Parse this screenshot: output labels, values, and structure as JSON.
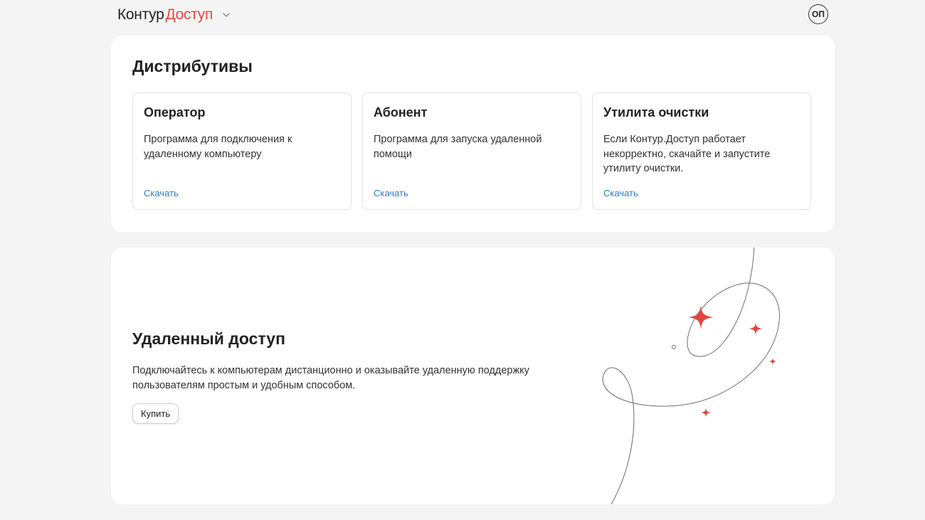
{
  "header": {
    "logo_brand": "Контур",
    "logo_product": "Доступ",
    "avatar_initials": "ОП"
  },
  "distributions": {
    "title": "Дистрибутивы",
    "cards": [
      {
        "title": "Оператор",
        "description": "Программа для подключения к удаленному компьютеру",
        "link_label": "Скачать"
      },
      {
        "title": "Абонент",
        "description": "Программа для запуска удаленной помощи",
        "link_label": "Скачать"
      },
      {
        "title": "Утилита очистки",
        "description": "Если Контур.Доступ работает некорректно, скачайте и запустите утилиту очистки.",
        "link_label": "Скачать"
      }
    ]
  },
  "remote_access": {
    "title": "Удаленный доступ",
    "description": "Подключайтесь к компьютерам дистанционно и оказывайте удаленную поддержку пользователям простым и удобным способом.",
    "buy_label": "Купить"
  },
  "colors": {
    "background": "#f4f4f4",
    "card": "#ffffff",
    "brand_red": "#e8473f",
    "link_blue": "#2b7bd5",
    "text": "#222222"
  },
  "icons": {
    "logo_dropdown": "chevron-down-icon",
    "illustration": "sparkle-star-icon"
  }
}
